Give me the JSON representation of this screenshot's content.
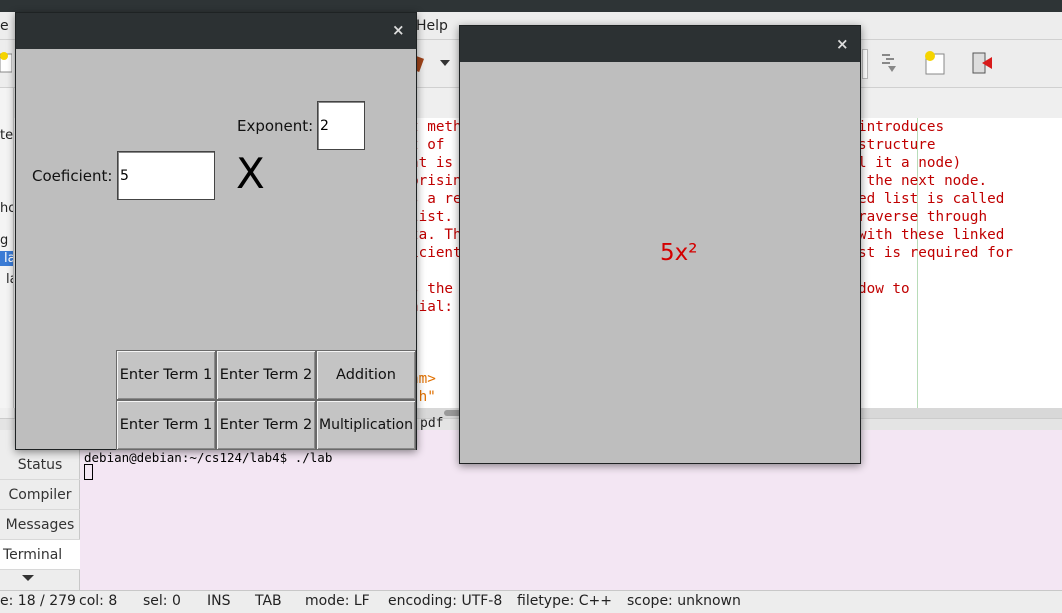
{
  "ide": {
    "menu": {
      "left_fragment": "e",
      "help": "Help"
    },
    "sidebar_fragments": [
      "ter",
      "ho",
      "g ..",
      "la",
      "la"
    ],
    "code_lines_right": [
      "introduces",
      "structure",
      "l it a node)",
      " the next node.",
      "ed list is called",
      "raverse through",
      "with these linked",
      "st is required for",
      "",
      "dow to"
    ],
    "code_lines_left": [
      "t meth",
      "t of ",
      "nt is",
      "prisin",
      "s a re",
      "list.",
      "ta. Th",
      "icient",
      "",
      "s the",
      "nial:"
    ],
    "code_lines_orange": [
      "am>",
      " h\""
    ],
    "pdf_fragment": "pdf",
    "message_tabs": [
      "Status",
      "Compiler",
      "Messages",
      "Terminal"
    ],
    "terminal_prompt": "debian@debian:~/cs124/lab4$ ./lab",
    "status_bar": {
      "line": "e: 18 / 279",
      "col": "col: 8",
      "sel": "sel: 0",
      "ins": "INS",
      "tab": "TAB",
      "mode": "mode: LF",
      "encoding": "encoding: UTF-8",
      "filetype": "filetype: C++",
      "scope": "scope: unknown"
    }
  },
  "input_window": {
    "close_glyph": "×",
    "exponent_label": "Exponent:",
    "exponent_value": "2",
    "coefficient_label": "Coeficient:",
    "coefficient_value": "5",
    "x_symbol": "X",
    "buttons_row1": [
      "Enter Term 1",
      "Enter Term 2",
      "Addition"
    ],
    "buttons_row2": [
      "Enter Term 1",
      "Enter Term 2",
      "Multiplication"
    ]
  },
  "output_window": {
    "close_glyph": "×",
    "result_text": "5x²"
  },
  "colors": {
    "window_bg": "#bebebe",
    "titlebar": "#2c3133",
    "code_text": "#c00000",
    "result_text": "#d40000",
    "terminal_bg": "#f3e6f3"
  }
}
